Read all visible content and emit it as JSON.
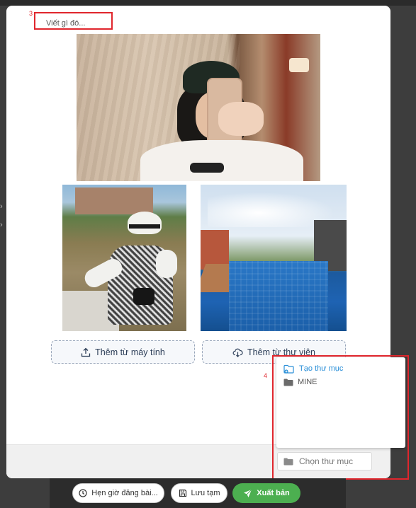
{
  "caption": {
    "placeholder": "Viết gì đó..."
  },
  "annotations": {
    "caption_marker": "3",
    "folder_marker": "4"
  },
  "photos": [
    {
      "subject": "mirror selfie"
    },
    {
      "subject": "girl in sun hat"
    },
    {
      "subject": "swimming pool"
    }
  ],
  "add_buttons": {
    "from_computer": "Thêm từ máy tính",
    "from_library": "Thêm từ thư viện"
  },
  "folder_menu": {
    "create_label": "Tạo thư mục",
    "items": [
      "MINE"
    ],
    "select_placeholder": "Chọn thư mục"
  },
  "actions": {
    "schedule": "Hẹn giờ đăng bài...",
    "draft": "Lưu tạm",
    "publish": "Xuất bản"
  },
  "colors": {
    "accent_blue": "#2a8fd8",
    "publish_green": "#4caf50",
    "annotation_red": "#e0262d"
  }
}
